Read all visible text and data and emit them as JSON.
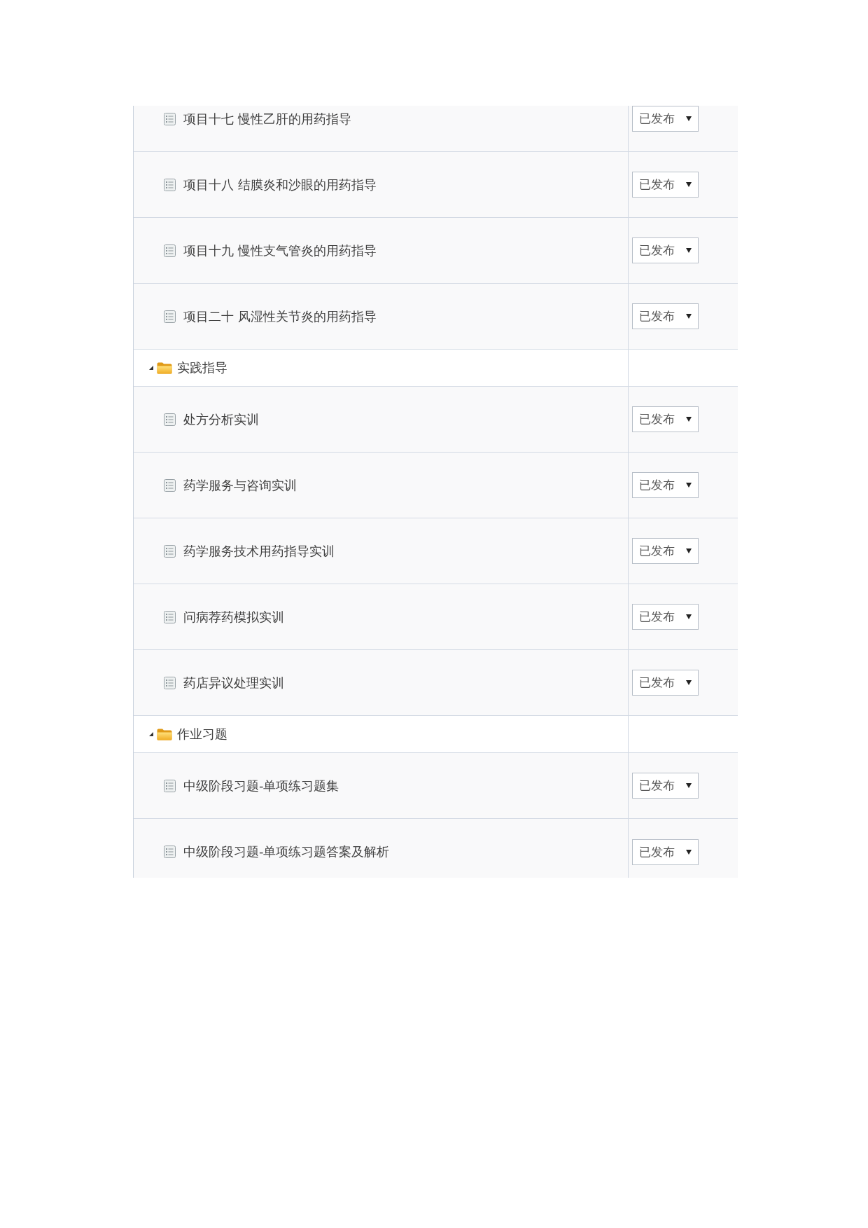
{
  "outline": [
    {
      "kind": "continued",
      "children": [
        {
          "title": "项目十七 慢性乙肝的用药指导",
          "status": "已发布"
        },
        {
          "title": "项目十八 结膜炎和沙眼的用药指导",
          "status": "已发布"
        },
        {
          "title": "项目十九 慢性支气管炎的用药指导",
          "status": "已发布"
        },
        {
          "title": "项目二十 风湿性关节炎的用药指导",
          "status": "已发布"
        }
      ]
    },
    {
      "kind": "folder",
      "title": "实践指导",
      "expanded": true,
      "children": [
        {
          "title": "处方分析实训",
          "status": "已发布"
        },
        {
          "title": "药学服务与咨询实训",
          "status": "已发布"
        },
        {
          "title": "药学服务技术用药指导实训",
          "status": "已发布"
        },
        {
          "title": "问病荐药模拟实训",
          "status": "已发布"
        },
        {
          "title": "药店异议处理实训",
          "status": "已发布"
        }
      ]
    },
    {
      "kind": "folder",
      "title": "作业习题",
      "expanded": true,
      "children": [
        {
          "title": "中级阶段习题-单项练习题集",
          "status": "已发布"
        },
        {
          "title": "中级阶段习题-单项练习题答案及解析",
          "status": "已发布"
        }
      ]
    }
  ]
}
